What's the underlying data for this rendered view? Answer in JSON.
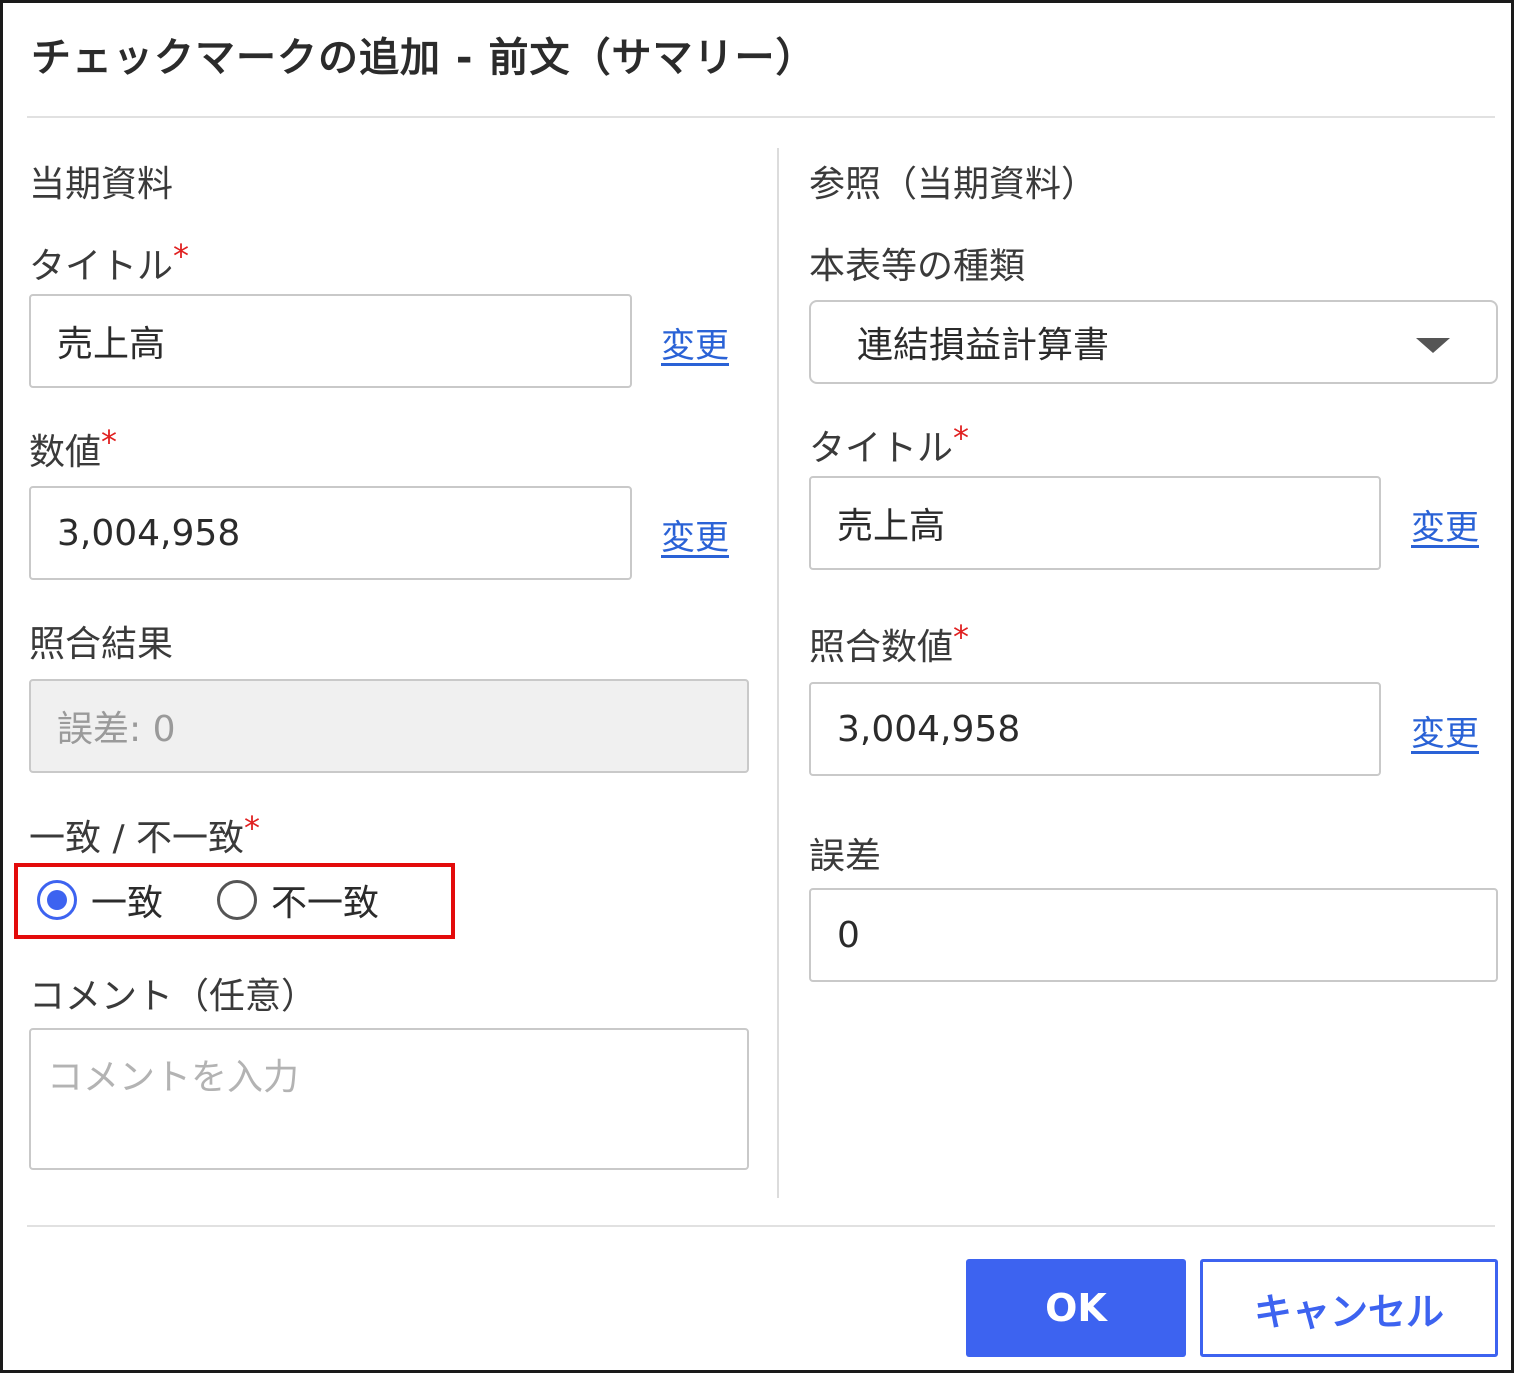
{
  "dialog": {
    "title": "チェックマークの追加 - 前文（サマリー）"
  },
  "left": {
    "heading": "当期資料",
    "title_label": "タイトル",
    "title_value": "売上高",
    "title_change": "変更",
    "value_label": "数値",
    "value_value": "3,004,958",
    "value_change": "変更",
    "result_label": "照合結果",
    "result_value": "誤差: 0",
    "match_label": "一致 / 不一致",
    "match_options": [
      "一致",
      "不一致"
    ],
    "match_selected": "一致",
    "comment_label": "コメント（任意）",
    "comment_placeholder": "コメントを入力"
  },
  "right": {
    "heading": "参照（当期資料）",
    "type_label": "本表等の種類",
    "type_value": "連結損益計算書",
    "title_label": "タイトル",
    "title_value": "売上高",
    "title_change": "変更",
    "check_value_label": "照合数値",
    "check_value_value": "3,004,958",
    "check_value_change": "変更",
    "diff_label": "誤差",
    "diff_value": "0"
  },
  "required_mark": "*",
  "buttons": {
    "ok": "OK",
    "cancel": "キャンセル"
  },
  "colors": {
    "accent": "#3d63f0",
    "link": "#2a62d6",
    "required": "#e02020",
    "highlight": "#e30b0b"
  }
}
